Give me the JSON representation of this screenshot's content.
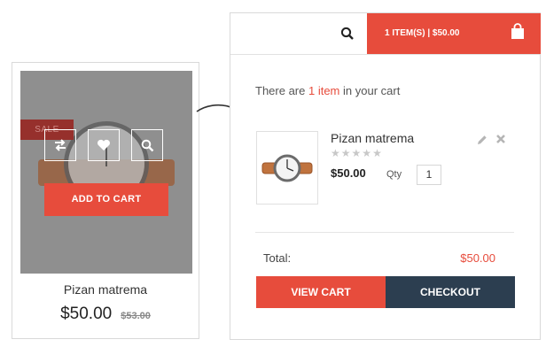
{
  "product": {
    "sale_badge": "SALE",
    "add_to_cart_label": "ADD TO CART",
    "name": "Pizan matrema",
    "price": "$50.00",
    "old_price": "$53.00",
    "actions": [
      "compare-icon",
      "heart-icon",
      "search-icon"
    ]
  },
  "cart": {
    "summary": "1 ITEM(S) | $50.00",
    "message_prefix": "There are ",
    "message_count": "1 item",
    "message_suffix": " in your cart",
    "item": {
      "name": "Pizan matrema",
      "rating": 0,
      "rating_max": 5,
      "price": "$50.00",
      "qty_label": "Qty",
      "qty": "1"
    },
    "total_label": "Total:",
    "total_value": "$50.00",
    "view_cart_label": "VIEW CART",
    "checkout_label": "CHECKOUT"
  },
  "colors": {
    "accent": "#e74c3c",
    "dark": "#2c3e50",
    "overlay": "#8f8f8f"
  }
}
